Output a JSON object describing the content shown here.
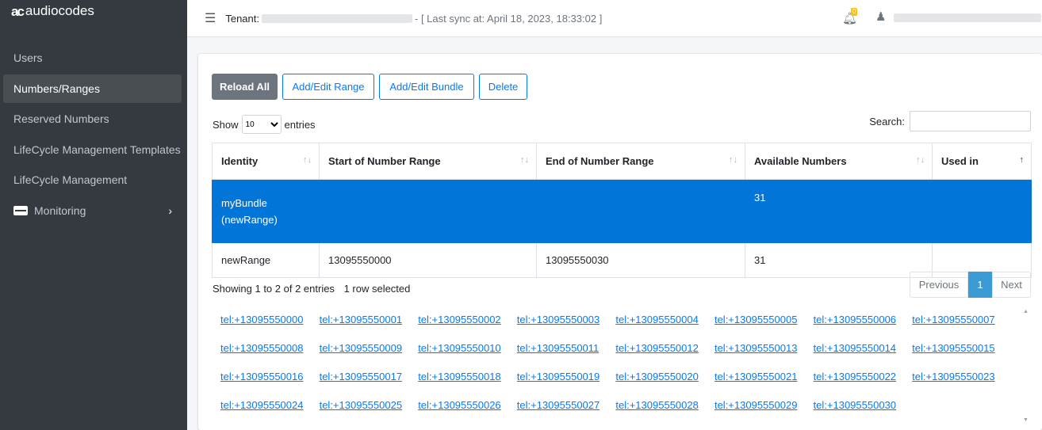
{
  "brand": {
    "logo": "ac",
    "name": "audiocodes"
  },
  "sidebar": {
    "items": [
      {
        "label": "Users"
      },
      {
        "label": "Numbers/Ranges"
      },
      {
        "label": "Reserved Numbers"
      },
      {
        "label": "LifeCycle Management Templates"
      },
      {
        "label": "LifeCycle Management"
      },
      {
        "label": "Monitoring"
      }
    ]
  },
  "topbar": {
    "tenant_label": "Tenant:",
    "sync_text": "- [ Last sync at: April 18, 2023, 18:33:02 ]",
    "notification_count": "0"
  },
  "toolbar": {
    "reload": "Reload All",
    "add_range": "Add/Edit Range",
    "add_bundle": "Add/Edit Bundle",
    "delete": "Delete"
  },
  "length": {
    "show": "Show",
    "value": "10",
    "entries": "entries"
  },
  "search": {
    "label": "Search:",
    "value": ""
  },
  "table": {
    "headers": [
      "Identity",
      "Start of Number Range",
      "End of Number Range",
      "Available Numbers",
      "Used in"
    ],
    "rows": [
      [
        "myBundle (newRange)",
        "",
        "",
        "31",
        ""
      ],
      [
        "newRange",
        "13095550000",
        "13095550030",
        "31",
        ""
      ]
    ]
  },
  "footer": {
    "info": "Showing 1 to 2 of 2 entries",
    "selected": "1 row selected"
  },
  "pagination": {
    "previous": "Previous",
    "current": "1",
    "next": "Next"
  },
  "tel_links": [
    "tel:+13095550000",
    "tel:+13095550001",
    "tel:+13095550002",
    "tel:+13095550003",
    "tel:+13095550004",
    "tel:+13095550005",
    "tel:+13095550006",
    "tel:+13095550007",
    "tel:+13095550008",
    "tel:+13095550009",
    "tel:+13095550010",
    "tel:+13095550011",
    "tel:+13095550012",
    "tel:+13095550013",
    "tel:+13095550014",
    "tel:+13095550015",
    "tel:+13095550016",
    "tel:+13095550017",
    "tel:+13095550018",
    "tel:+13095550019",
    "tel:+13095550020",
    "tel:+13095550021",
    "tel:+13095550022",
    "tel:+13095550023",
    "tel:+13095550024",
    "tel:+13095550025",
    "tel:+13095550026",
    "tel:+13095550027",
    "tel:+13095550028",
    "tel:+13095550029",
    "tel:+13095550030"
  ],
  "colors": {
    "sidebar_bg": "#343a40",
    "accent": "#007bff",
    "selected_row": "#0275d8",
    "badge": "#ffc107"
  }
}
